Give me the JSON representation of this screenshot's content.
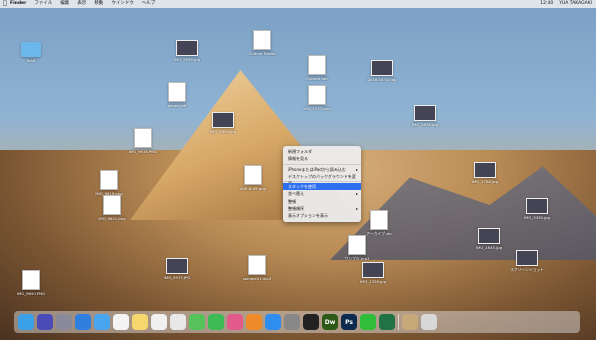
{
  "menubar": {
    "app": "Finder",
    "items": [
      "ファイル",
      "編集",
      "表示",
      "移動",
      "ウインドウ",
      "ヘルプ"
    ],
    "clock": "12:40",
    "user": "YUA TAKAGAKI"
  },
  "desktop_icons": [
    {
      "label": "load",
      "kind": "folder"
    },
    {
      "label": "Culture Folder",
      "kind": "doc"
    },
    {
      "label": "IMG_5930.jpg",
      "kind": "photo"
    },
    {
      "label": "Culture tab",
      "kind": "doc"
    },
    {
      "label": "IMG_1721.png",
      "kind": "doc"
    },
    {
      "label": "pages.pdf",
      "kind": "doc"
    },
    {
      "label": "2018.04.02.jpg",
      "kind": "photo"
    },
    {
      "label": "AVE-6-09.png",
      "kind": "doc"
    },
    {
      "label": "IMG_9616.PNG",
      "kind": "doc"
    },
    {
      "label": "IMG_9619.png",
      "kind": "doc"
    },
    {
      "label": "IMG_9621.png",
      "kind": "doc"
    },
    {
      "label": "IMG_5905.jpg",
      "kind": "photo"
    },
    {
      "label": "IMG_1788.jpg",
      "kind": "photo"
    },
    {
      "label": "スクリーンショット",
      "kind": "photo"
    },
    {
      "label": "IMG_9635.jpg",
      "kind": "photo"
    },
    {
      "label": "アーカイブ.zip",
      "kind": "doc"
    },
    {
      "label": "IMG_3430.jpg",
      "kind": "photo"
    },
    {
      "label": "サンプル.mp3",
      "kind": "doc"
    },
    {
      "label": "IMG_1328.jpg",
      "kind": "photo"
    },
    {
      "label": "IMG_9650.PNG",
      "kind": "doc"
    },
    {
      "label": "sample01.mp3",
      "kind": "doc"
    },
    {
      "label": "IMG_5973.JPG",
      "kind": "photo"
    },
    {
      "label": "IMG_1645.jpg",
      "kind": "photo"
    }
  ],
  "context_menu": [
    {
      "label": "新規フォルダ"
    },
    {
      "label": "情報を見る"
    },
    {
      "label": "iPhoneまたはiPadから読み込む",
      "submenu": true
    },
    {
      "label": "デスクトップのバックグラウンドを変更"
    },
    {
      "label": "スタックを使用",
      "selected": true
    },
    {
      "label": "並べ替え",
      "submenu": true
    },
    {
      "label": "整頓"
    },
    {
      "label": "整頓順序",
      "submenu": true
    },
    {
      "label": "表示オプションを表示"
    }
  ],
  "dock": [
    {
      "name": "finder",
      "color": "#3aa0e8"
    },
    {
      "name": "siri",
      "color": "#4b4bb8"
    },
    {
      "name": "launchpad",
      "color": "#8a8a9a"
    },
    {
      "name": "safari",
      "color": "#2f7fe0"
    },
    {
      "name": "mail",
      "color": "#4aa5f0"
    },
    {
      "name": "calendar",
      "color": "#f4f4f4"
    },
    {
      "name": "notes",
      "color": "#f5d76e"
    },
    {
      "name": "reminders",
      "color": "#f0f0f0"
    },
    {
      "name": "photos",
      "color": "#e8e8e8"
    },
    {
      "name": "messages",
      "color": "#55c25a"
    },
    {
      "name": "facetime",
      "color": "#3dbb55"
    },
    {
      "name": "itunes",
      "color": "#e25a8a"
    },
    {
      "name": "books",
      "color": "#ef8b2a"
    },
    {
      "name": "app-store",
      "color": "#2e8ef0"
    },
    {
      "name": "system-preferences",
      "color": "#888"
    },
    {
      "name": "terminal",
      "color": "#222"
    },
    {
      "name": "dreamweaver",
      "color": "#2d5a16",
      "text": "Dw"
    },
    {
      "name": "photoshop",
      "color": "#0d2a4f",
      "text": "Ps"
    },
    {
      "name": "line",
      "color": "#2fbd3a"
    },
    {
      "name": "excel",
      "color": "#217346"
    },
    {
      "name": "downloads",
      "color": "#c8a778"
    },
    {
      "name": "trash",
      "color": "#d8d8d8"
    }
  ]
}
